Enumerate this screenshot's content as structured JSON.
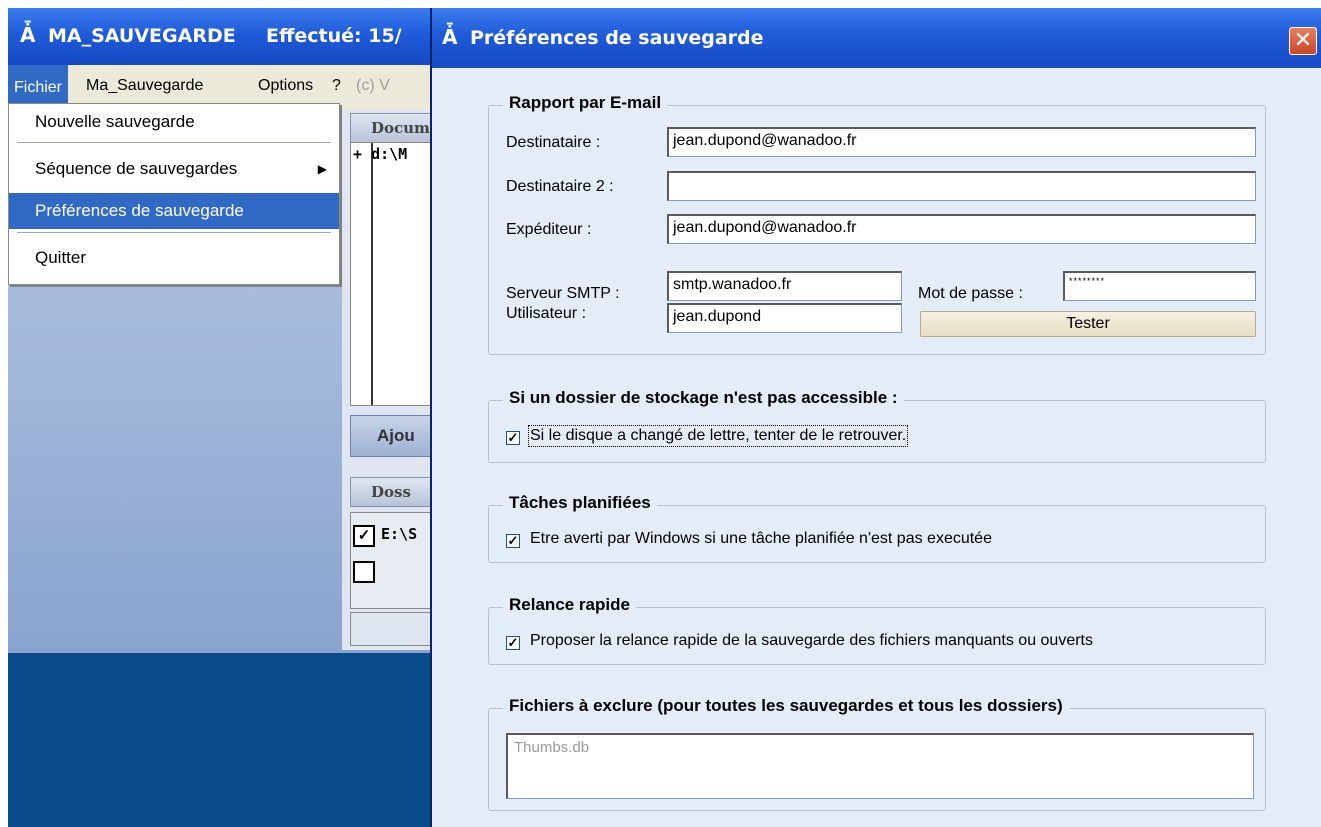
{
  "main_window": {
    "title": "MA_SAUVEGARDE",
    "status": "Effectué: 15/",
    "menu": [
      "Fichier",
      "Ma_Sauvegarde",
      "Options",
      "?",
      "(c) V"
    ],
    "documents_header": "Docum",
    "first_document": "d:\\M",
    "add_button_label": "Ajou",
    "destinations_header": "Doss",
    "first_destination": "E:\\S"
  },
  "file_menu": {
    "items": [
      {
        "label": "Nouvelle sauvegarde"
      },
      {
        "label": "Séquence de sauvegardes",
        "submenu": true
      },
      {
        "label": "Préférences de sauvegarde",
        "selected": true
      },
      {
        "label": "Quitter"
      }
    ]
  },
  "dialog": {
    "title": "Préférences de sauvegarde",
    "close_glyph": "✕",
    "email_report": {
      "title": "Rapport par E-mail",
      "recipient_label": "Destinataire :",
      "recipient_value": "jean.dupond@wanadoo.fr",
      "recipient2_label": "Destinataire 2 :",
      "recipient2_value": "",
      "sender_label": "Expéditeur :",
      "sender_value": "jean.dupond@wanadoo.fr",
      "smtp_label": "Serveur SMTP :",
      "smtp_value": "smtp.wanadoo.fr",
      "user_label": "Utilisateur :",
      "user_value": "jean.dupond",
      "password_label": "Mot de passe :",
      "password_value": "********",
      "test_button": "Tester"
    },
    "storage": {
      "title": "Si un dossier de stockage n'est pas accessible :",
      "option": "Si le disque a changé de lettre, tenter de le retrouver.",
      "checked": true
    },
    "scheduled": {
      "title": "Tâches planifiées",
      "option": "Etre averti par Windows si une tâche planifiée n'est pas executée",
      "checked": true
    },
    "quick_restart": {
      "title": "Relance rapide",
      "option": "Proposer la relance rapide de la sauvegarde des fichiers manquants ou ouverts",
      "checked": true
    },
    "exclude": {
      "title": "Fichiers à exclure (pour toutes les sauvegardes et tous les dossiers)",
      "value": "Thumbs.db"
    }
  },
  "colors": {
    "titlebar": "#1f5bd8",
    "menu_highlight": "#316ac5",
    "dialog_bg": "#e3ecf7",
    "desktop": "#0a4b8c"
  }
}
